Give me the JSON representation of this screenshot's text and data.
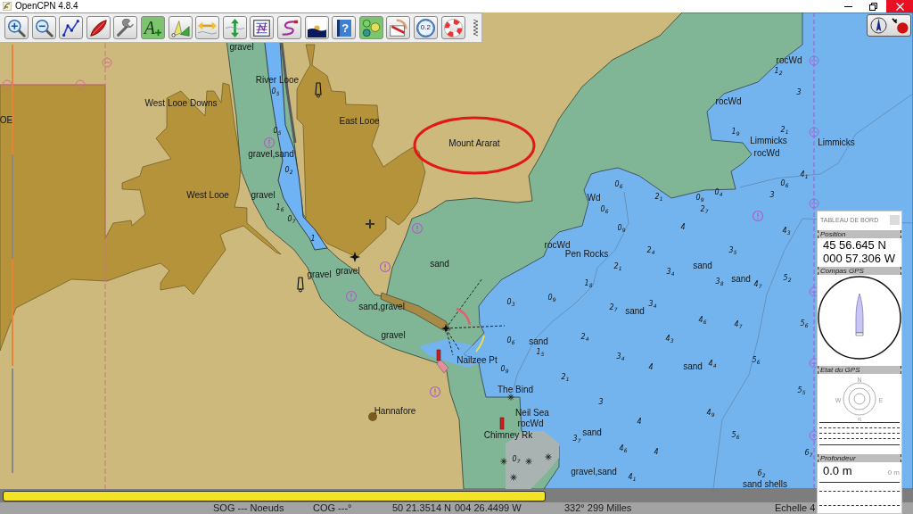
{
  "window": {
    "title": "OpenCPN 4.8.4"
  },
  "toolbar": {
    "tools": [
      {
        "kind": "zoom_in",
        "on": false
      },
      {
        "kind": "zoom_out",
        "on": false
      },
      {
        "kind": "route",
        "on": false
      },
      {
        "kind": "ownship",
        "on": false
      },
      {
        "kind": "settings",
        "on": false
      },
      {
        "kind": "text",
        "text": "A",
        "on": true
      },
      {
        "kind": "mark",
        "on": false
      },
      {
        "kind": "measure_h",
        "on": false
      },
      {
        "kind": "measure_v",
        "on": false
      },
      {
        "kind": "route_list",
        "on": false
      },
      {
        "kind": "track",
        "on": false
      },
      {
        "kind": "tides",
        "on": false
      },
      {
        "kind": "help",
        "text": "?",
        "on": false
      },
      {
        "kind": "layers",
        "on": true
      },
      {
        "kind": "print",
        "on": false
      },
      {
        "kind": "scale",
        "text": "0.2",
        "on": false
      },
      {
        "kind": "lifebuoy",
        "on": false
      }
    ]
  },
  "nautical_chart": {
    "labels": [
      {
        "kind": "seabed",
        "text": "gravel"
      },
      {
        "kind": "seabed",
        "text": "rocWd"
      },
      {
        "kind": "sounding",
        "text": "1$_{2}$"
      },
      {
        "kind": "place",
        "text": "River Looe"
      },
      {
        "kind": "sounding",
        "text": "0$_{5}$"
      },
      {
        "kind": "sounding",
        "text": "3"
      },
      {
        "kind": "place",
        "text": "West Looe Downs"
      },
      {
        "kind": "seabed",
        "text": "rocWd"
      },
      {
        "kind": "place",
        "text": "OE"
      },
      {
        "kind": "place",
        "text": "East Looe"
      },
      {
        "kind": "sounding",
        "text": "0$_{5}$"
      },
      {
        "kind": "sounding",
        "text": "1$_{9}$"
      },
      {
        "kind": "sounding",
        "text": "2$_{1}$"
      },
      {
        "kind": "place",
        "text": "Mount Ararat"
      },
      {
        "kind": "place",
        "text": "Limmicks"
      },
      {
        "kind": "place",
        "text": "Limmicks"
      },
      {
        "kind": "seabed",
        "text": "gravel,sand"
      },
      {
        "kind": "seabed",
        "text": "rocWd"
      },
      {
        "kind": "sounding",
        "text": "0$_{2}$"
      },
      {
        "kind": "sounding",
        "text": "4$_{1}$"
      },
      {
        "kind": "sounding",
        "text": "0$_{6}$"
      },
      {
        "kind": "sounding",
        "text": "0$_{6}$"
      },
      {
        "kind": "place",
        "text": "West Looe"
      },
      {
        "kind": "seabed",
        "text": "gravel"
      },
      {
        "kind": "seabed",
        "text": "Wd"
      },
      {
        "kind": "sounding",
        "text": "2$_{1}$"
      },
      {
        "kind": "sounding",
        "text": "0$_{9}$"
      },
      {
        "kind": "sounding",
        "text": "0$_{4}$"
      },
      {
        "kind": "sounding",
        "text": "3"
      },
      {
        "kind": "sounding",
        "text": "1$_{6}$"
      },
      {
        "kind": "sounding",
        "text": "0$_{6}$"
      },
      {
        "kind": "sounding",
        "text": "2$_{7}$"
      },
      {
        "kind": "sounding",
        "text": "0$_{7}$"
      },
      {
        "kind": "sounding",
        "text": "0$_{9}$"
      },
      {
        "kind": "sounding",
        "text": "4"
      },
      {
        "kind": "sounding",
        "text": "4$_{3}$"
      },
      {
        "kind": "sounding",
        "text": "1"
      },
      {
        "kind": "seabed",
        "text": "rocWd"
      },
      {
        "kind": "place",
        "text": "Pen Rocks"
      },
      {
        "kind": "sounding",
        "text": "2$_{4}$"
      },
      {
        "kind": "sounding",
        "text": "3$_{5}$"
      },
      {
        "kind": "seabed",
        "text": "gravel"
      },
      {
        "kind": "seabed",
        "text": "gravel"
      },
      {
        "kind": "seabed",
        "text": "sand"
      },
      {
        "kind": "sounding",
        "text": "1$_{8}$"
      },
      {
        "kind": "sounding",
        "text": "2$_{1}$"
      },
      {
        "kind": "sounding",
        "text": "3$_{4}$"
      },
      {
        "kind": "seabed",
        "text": "sand"
      },
      {
        "kind": "sounding",
        "text": "3$_{8}$"
      },
      {
        "kind": "seabed",
        "text": "sand"
      },
      {
        "kind": "sounding",
        "text": "4$_{7}$"
      },
      {
        "kind": "sounding",
        "text": "5$_{2}$"
      },
      {
        "kind": "seabed",
        "text": "sand,gravel"
      },
      {
        "kind": "sounding",
        "text": "0$_{3}$"
      },
      {
        "kind": "sounding",
        "text": "0$_{9}$"
      },
      {
        "kind": "sounding",
        "text": "2$_{7}$"
      },
      {
        "kind": "seabed",
        "text": "sand"
      },
      {
        "kind": "sounding",
        "text": "3$_{4}$"
      },
      {
        "kind": "sounding",
        "text": "4$_{6}$"
      },
      {
        "kind": "sounding",
        "text": "4$_{7}$"
      },
      {
        "kind": "sounding",
        "text": "5$_{6}$"
      },
      {
        "kind": "seabed",
        "text": "gravel"
      },
      {
        "kind": "sounding",
        "text": "0$_{6}$"
      },
      {
        "kind": "seabed",
        "text": "sand"
      },
      {
        "kind": "sounding",
        "text": "2$_{4}$"
      },
      {
        "kind": "sounding",
        "text": "4$_{3}$"
      },
      {
        "kind": "place",
        "text": "Nailzee Pt"
      },
      {
        "kind": "sounding",
        "text": "0$_{9}$"
      },
      {
        "kind": "sounding",
        "text": "1$_{5}$"
      },
      {
        "kind": "sounding",
        "text": "3$_{4}$"
      },
      {
        "kind": "sounding",
        "text": "4"
      },
      {
        "kind": "seabed",
        "text": "sand"
      },
      {
        "kind": "sounding",
        "text": "4$_{4}$"
      },
      {
        "kind": "sounding",
        "text": "5$_{6}$"
      },
      {
        "kind": "sounding",
        "text": "2$_{1}$"
      },
      {
        "kind": "place",
        "text": "The Bind"
      },
      {
        "kind": "sounding",
        "text": "5$_{5}$"
      },
      {
        "kind": "sounding",
        "text": "3"
      },
      {
        "kind": "place",
        "text": "Hannafore"
      },
      {
        "kind": "place",
        "text": "Neil Sea"
      },
      {
        "kind": "sounding",
        "text": "4$_{9}$"
      },
      {
        "kind": "seabed",
        "text": "rocWd"
      },
      {
        "kind": "sounding",
        "text": "4"
      },
      {
        "kind": "place",
        "text": "Chimney Rk"
      },
      {
        "kind": "sounding",
        "text": "3$_{7}$"
      },
      {
        "kind": "seabed",
        "text": "sand"
      },
      {
        "kind": "sounding",
        "text": "5$_{6}$"
      },
      {
        "kind": "sounding",
        "text": "0$_{7}$"
      },
      {
        "kind": "sounding",
        "text": "4$_{6}$"
      },
      {
        "kind": "sounding",
        "text": "4"
      },
      {
        "kind": "sounding",
        "text": "6$_{7}$"
      },
      {
        "kind": "seabed",
        "text": "gravel,sand"
      },
      {
        "kind": "sounding",
        "text": "4$_{1}$"
      },
      {
        "kind": "sounding",
        "text": "6$_{2}$"
      },
      {
        "kind": "seabed",
        "text": "sand shells"
      }
    ]
  },
  "dashboard": {
    "title": "TABLEAU DE BORD",
    "instruments": [
      {
        "kind": "position",
        "title": "Position",
        "lines": [
          "45 56.645 N",
          "000 57.306 W"
        ]
      },
      {
        "kind": "compass",
        "title": "Compas GPS"
      },
      {
        "kind": "gps_status",
        "title": "Etat du GPS",
        "directions": [
          "N",
          "E",
          "S",
          "W"
        ]
      },
      {
        "kind": "depth",
        "title": "Profondeur",
        "value": "0.0 m",
        "scale": "0 m"
      }
    ]
  },
  "chart_bar": {
    "keys": [
      {
        "selected": true
      }
    ]
  },
  "status_bar": {
    "fields": [
      "SOG --- Noeuds",
      "COG ---°",
      "50 21.3514 N",
      "004 26.4499 W",
      "332° 299 Milles",
      "Echelle 4"
    ]
  }
}
